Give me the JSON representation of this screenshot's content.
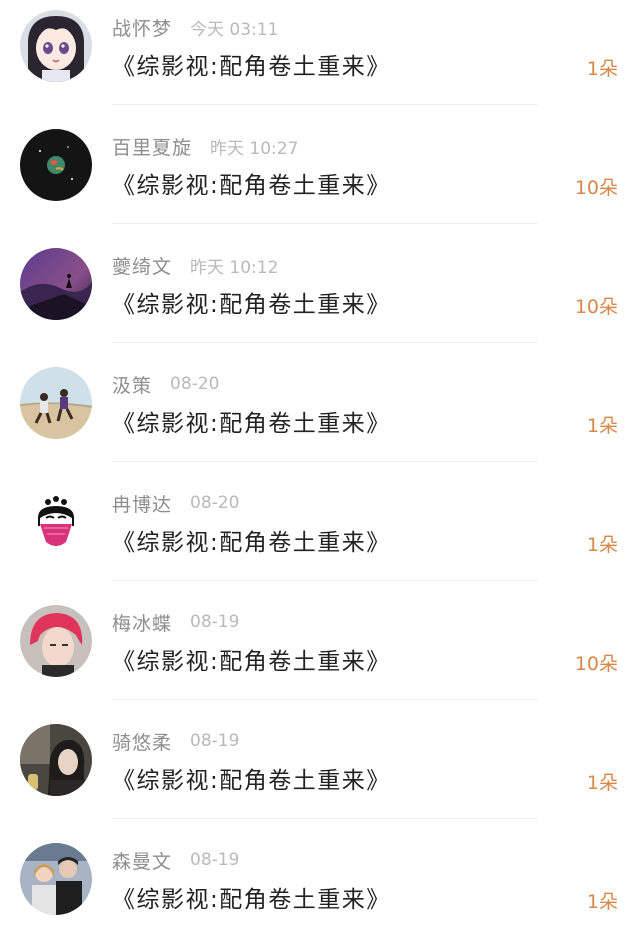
{
  "accent_color": "#d9884a",
  "items": [
    {
      "name": "战怀梦",
      "time": "今天 03:11",
      "book": "《综影视:配角卷土重来》",
      "count": "1朵",
      "avatar_icon": "anime-girl-avatar-icon"
    },
    {
      "name": "百里夏旋",
      "time": "昨天 10:27",
      "book": "《综影视:配角卷土重来》",
      "count": "10朵",
      "avatar_icon": "planet-avatar-icon"
    },
    {
      "name": "夔绮文",
      "time": "昨天 10:12",
      "book": "《综影视:配角卷土重来》",
      "count": "10朵",
      "avatar_icon": "purple-landscape-avatar-icon"
    },
    {
      "name": "汲策",
      "time": "08-20",
      "book": "《综影视:配角卷土重来》",
      "count": "1朵",
      "avatar_icon": "beach-runners-avatar-icon"
    },
    {
      "name": "冉博达",
      "time": "08-20",
      "book": "《综影视:配角卷土重来》",
      "count": "1朵",
      "avatar_icon": "masked-woman-avatar-icon"
    },
    {
      "name": "梅冰蝶",
      "time": "08-19",
      "book": "《综影视:配角卷土重来》",
      "count": "10朵",
      "avatar_icon": "red-hair-portrait-avatar-icon"
    },
    {
      "name": "骑悠柔",
      "time": "08-19",
      "book": "《综影视:配角卷土重来》",
      "count": "1朵",
      "avatar_icon": "car-selfie-avatar-icon"
    },
    {
      "name": "森曼文",
      "time": "08-19",
      "book": "《综影视:配角卷土重来》",
      "count": "1朵",
      "avatar_icon": "couple-photo-avatar-icon"
    }
  ]
}
